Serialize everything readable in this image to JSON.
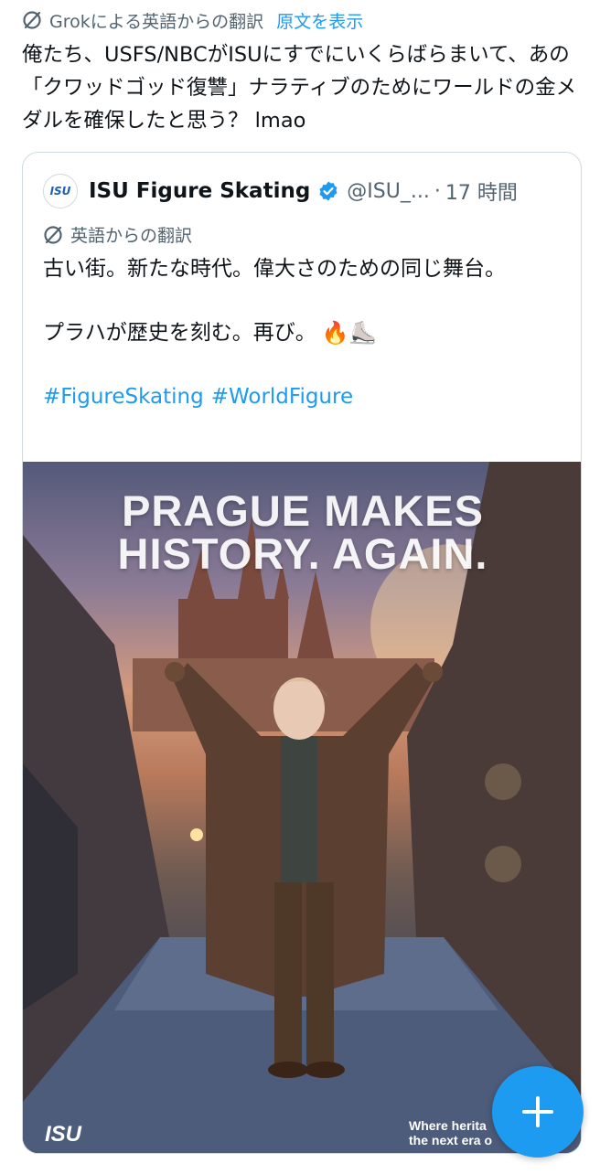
{
  "grok": {
    "translated_by": "Grokによる英語からの翻訳",
    "show_original": "原文を表示"
  },
  "tweet": {
    "text": "俺たち、USFS/NBCがISUにすでにいくらばらまいて、あの「クワッドゴッド復讐」ナラティブのためにワールドの金メダルを確保したと思う？ lmao"
  },
  "quote": {
    "avatar_text": "ISU",
    "name": "ISU Figure Skating",
    "handle": "@ISU_...",
    "dot": "·",
    "time": "17 時間",
    "translated_label": "英語からの翻訳",
    "line1": "古い街。新たな時代。偉大さのための同じ舞台。",
    "line2": "プラハが歴史を刻む。再び。",
    "emoji": "🔥⛸️",
    "hashtags": [
      "#FigureSkating",
      "#WorldFigure"
    ],
    "media": {
      "headline_1": "PRAGUE MAKES",
      "headline_2": "HISTORY. AGAIN.",
      "logo": "ISU",
      "tagline_1": "Where herita",
      "tagline_2": "the next era o"
    }
  },
  "colors": {
    "accent": "#1d9bf0",
    "secondary_text": "#536471",
    "border": "#cfd9de"
  },
  "icons": {
    "translate": "grok-translate-icon",
    "verified": "verified-badge-icon",
    "fab": "plus-icon"
  }
}
